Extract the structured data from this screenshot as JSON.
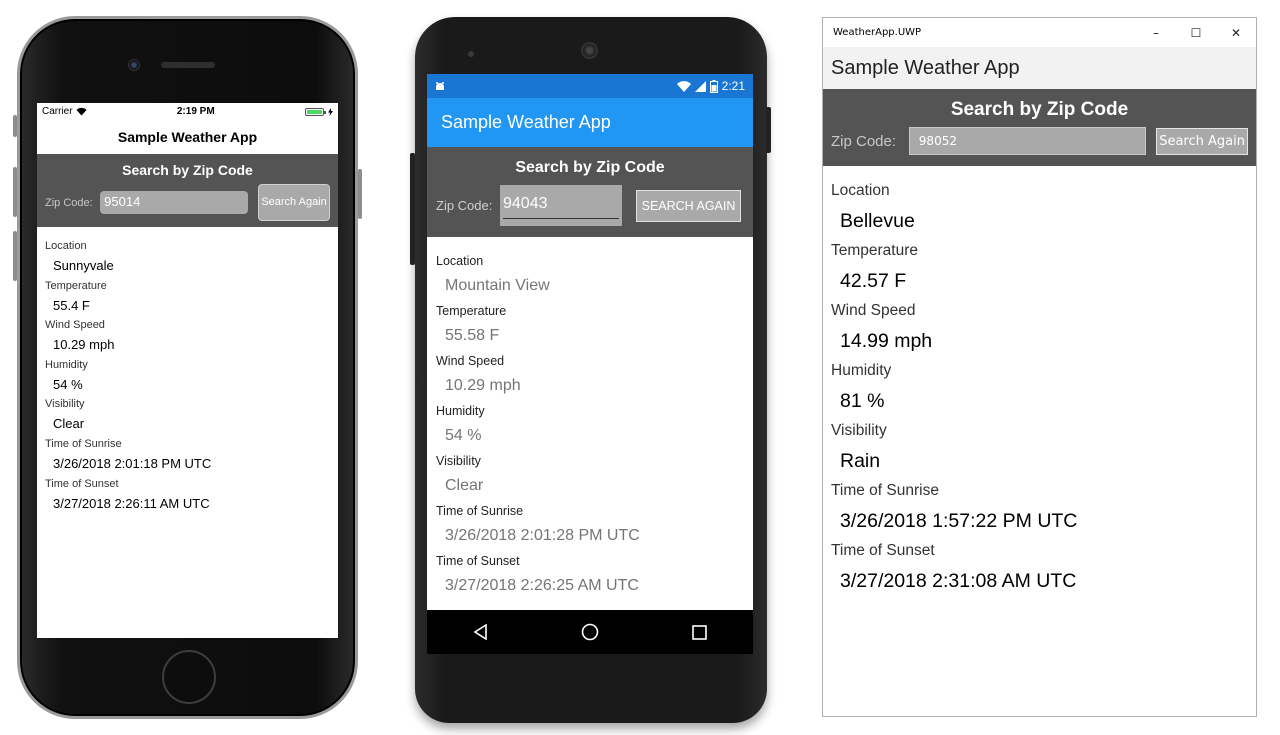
{
  "labels": {
    "location": "Location",
    "temperature": "Temperature",
    "wind_speed": "Wind Speed",
    "humidity": "Humidity",
    "visibility": "Visibility",
    "sunrise": "Time of Sunrise",
    "sunset": "Time of Sunset"
  },
  "ios": {
    "status": {
      "carrier": "Carrier",
      "time": "2:19 PM"
    },
    "title": "Sample Weather App",
    "search_heading": "Search by Zip Code",
    "zip_label": "Zip Code:",
    "zip_value": "95014",
    "button": "Search Again",
    "values": {
      "location": "Sunnyvale",
      "temperature": "55.4 F",
      "wind_speed": "10.29 mph",
      "humidity": "54 %",
      "visibility": "Clear",
      "sunrise": "3/26/2018 2:01:18 PM UTC",
      "sunset": "3/27/2018 2:26:11 AM UTC"
    }
  },
  "android": {
    "status": {
      "time": "2:21"
    },
    "title": "Sample Weather App",
    "search_heading": "Search by Zip Code",
    "zip_label": "Zip Code:",
    "zip_value": "94043",
    "button": "SEARCH AGAIN",
    "values": {
      "location": "Mountain View",
      "temperature": "55.58 F",
      "wind_speed": "10.29 mph",
      "humidity": "54 %",
      "visibility": "Clear",
      "sunrise": "3/26/2018 2:01:28 PM UTC",
      "sunset": "3/27/2018 2:26:25 AM UTC"
    }
  },
  "uwp": {
    "window_title": "WeatherApp.UWP",
    "title": "Sample Weather App",
    "search_heading": "Search by Zip Code",
    "zip_label": "Zip Code:",
    "zip_value": "98052",
    "button": "Search Again",
    "values": {
      "location": "Bellevue",
      "temperature": "42.57 F",
      "wind_speed": "14.99 mph",
      "humidity": "81 %",
      "visibility": "Rain",
      "sunrise": "3/26/2018 1:57:22 PM UTC",
      "sunset": "3/27/2018 2:31:08 AM UTC"
    }
  },
  "colors": {
    "search_panel": "#545454",
    "android_appbar": "#2196f3",
    "android_statusbar": "#1976d2",
    "field_gray": "#a9a9a9"
  }
}
